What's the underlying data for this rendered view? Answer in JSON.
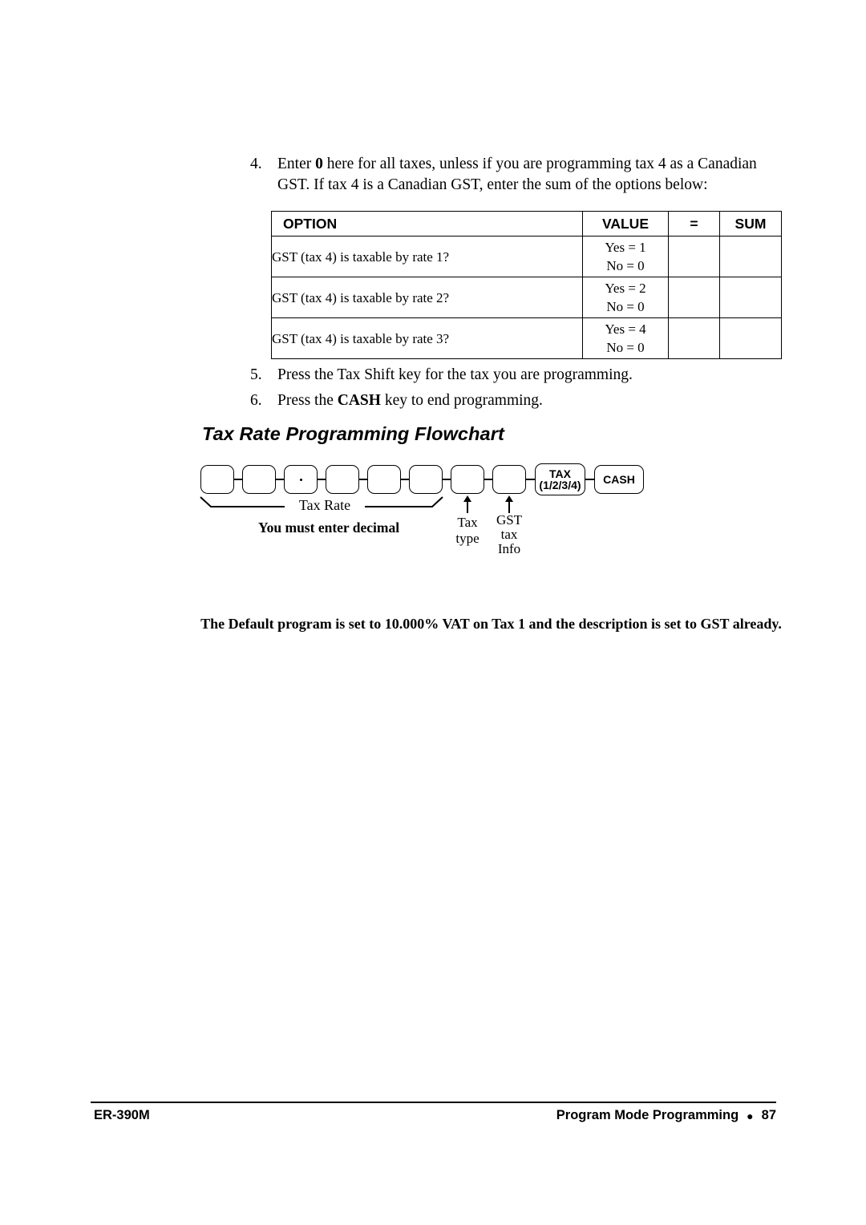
{
  "steps": [
    {
      "number": "4.",
      "text_before": "Enter ",
      "bold": "0",
      "text_after": " here for all taxes, unless if you are programming tax 4 as a Canadian GST.   If tax 4 is a Canadian GST, enter the sum of the options below:"
    },
    {
      "number": "5.",
      "text": "Press the Tax Shift key for the tax you are programming."
    },
    {
      "number": "6.",
      "text_before": "Press the ",
      "bold": "CASH",
      "text_after": " key to end programming."
    }
  ],
  "option_table": {
    "headers": [
      "OPTION",
      "VALUE",
      "=",
      "SUM"
    ],
    "rows": [
      {
        "option": "GST (tax 4) is taxable by rate 1?",
        "value_yes": "Yes = 1",
        "value_no": "No = 0",
        "equals": "",
        "sum": ""
      },
      {
        "option": "GST (tax 4) is taxable by rate 2?",
        "value_yes": "Yes = 2",
        "value_no": "No = 0",
        "equals": "",
        "sum": ""
      },
      {
        "option": "GST (tax 4) is taxable by rate 3?",
        "value_yes": "Yes = 4",
        "value_no": "No = 0",
        "equals": "",
        "sum": ""
      }
    ]
  },
  "flowchart": {
    "heading": "Tax Rate Programming Flowchart",
    "keys": [
      {
        "label": "",
        "type": "blank"
      },
      {
        "label": "",
        "type": "blank"
      },
      {
        "label": ".",
        "type": "decimal"
      },
      {
        "label": "",
        "type": "blank"
      },
      {
        "label": "",
        "type": "blank"
      },
      {
        "label": "",
        "type": "blank"
      },
      {
        "label": "",
        "type": "blank"
      },
      {
        "label": "",
        "type": "blank"
      },
      {
        "label_line1": "TAX",
        "label_line2": "(1/2/3/4)",
        "type": "tax"
      },
      {
        "label": "CASH",
        "type": "cash"
      }
    ],
    "brace_label": "Tax Rate",
    "decimal_note": "You must enter decimal",
    "annotations": [
      {
        "line1": "Tax",
        "line2": "type"
      },
      {
        "line1": "GST",
        "line2": "tax",
        "line3": "Info"
      }
    ]
  },
  "default_note": "The Default program is set to 10.000% VAT on Tax 1 and the description is set to GST already.",
  "footer": {
    "left": "ER-390M",
    "section": "Program Mode Programming",
    "bullet": "●",
    "page_number": "87"
  }
}
